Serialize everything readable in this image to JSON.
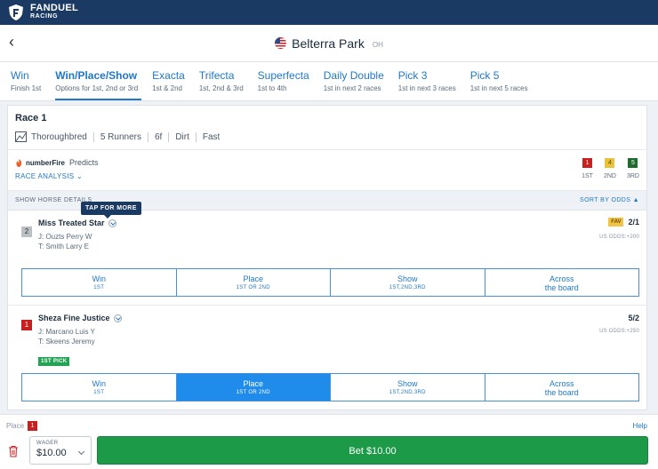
{
  "brand": {
    "line1": "FANDUEL",
    "line2": "RACING"
  },
  "header": {
    "back": "‹",
    "track_name": "Belterra Park",
    "track_code": "OH"
  },
  "tabs": [
    {
      "label": "Win",
      "sub": "Finish 1st"
    },
    {
      "label": "Win/Place/Show",
      "sub": "Options for 1st, 2nd or 3rd"
    },
    {
      "label": "Exacta",
      "sub": "1st & 2nd"
    },
    {
      "label": "Trifecta",
      "sub": "1st, 2nd & 3rd"
    },
    {
      "label": "Superfecta",
      "sub": "1st to 4th"
    },
    {
      "label": "Daily Double",
      "sub": "1st in next 2 races"
    },
    {
      "label": "Pick 3",
      "sub": "1st in next 3 races"
    },
    {
      "label": "Pick 5",
      "sub": "1st in next 5 races"
    }
  ],
  "race": {
    "title": "Race 1",
    "breed": "Thoroughbred",
    "runners": "5 Runners",
    "distance": "6f",
    "surface": "Dirt",
    "condition": "Fast"
  },
  "predicts": {
    "brand": "numberFire",
    "label": "Predicts",
    "analysis": "RACE ANALYSIS",
    "picks": [
      {
        "number": "1",
        "label": "1ST",
        "color": "#c8201e"
      },
      {
        "number": "4",
        "label": "2ND",
        "color": "#e8c33a"
      },
      {
        "number": "5",
        "label": "3RD",
        "color": "#1e6b2e"
      }
    ]
  },
  "list_bar": {
    "show_details": "SHOW HORSE DETAILS",
    "sort": "SORT BY ODDS ▲"
  },
  "tooltip": "TAP FOR MORE",
  "runners": [
    {
      "saddle": "2",
      "saddle_color": "#b9c0c6",
      "name": "Miss Treated Star",
      "jockey": "J: Ouzts Perry W",
      "trainer": "T: Smith Larry E",
      "fav": "FAV",
      "odds": "2/1",
      "us_odds": "US ODDS:+200",
      "buttons": [
        {
          "main": "Win",
          "sub": "1ST"
        },
        {
          "main": "Place",
          "sub": "1ST OR 2ND"
        },
        {
          "main": "Show",
          "sub": "1ST,2ND,3RD"
        },
        {
          "main": "Across",
          "sub": "the board"
        }
      ]
    },
    {
      "saddle": "1",
      "saddle_color": "#c8201e",
      "name": "Sheza Fine Justice",
      "jockey": "J: Marcano Luis Y",
      "trainer": "T: Skeens Jeremy",
      "badge": "1ST PICK",
      "odds": "5/2",
      "us_odds": "US ODDS:+250",
      "buttons": [
        {
          "main": "Win",
          "sub": "1ST"
        },
        {
          "main": "Place",
          "sub": "1ST OR 2ND"
        },
        {
          "main": "Show",
          "sub": "1ST,2ND,3RD"
        },
        {
          "main": "Across",
          "sub": "the board"
        }
      ]
    }
  ],
  "betslip": {
    "type": "Place",
    "saddle": "1",
    "help": "Help",
    "wager_label": "WAGER",
    "wager_value": "$10.00",
    "bet_label": "Bet $10.00"
  }
}
